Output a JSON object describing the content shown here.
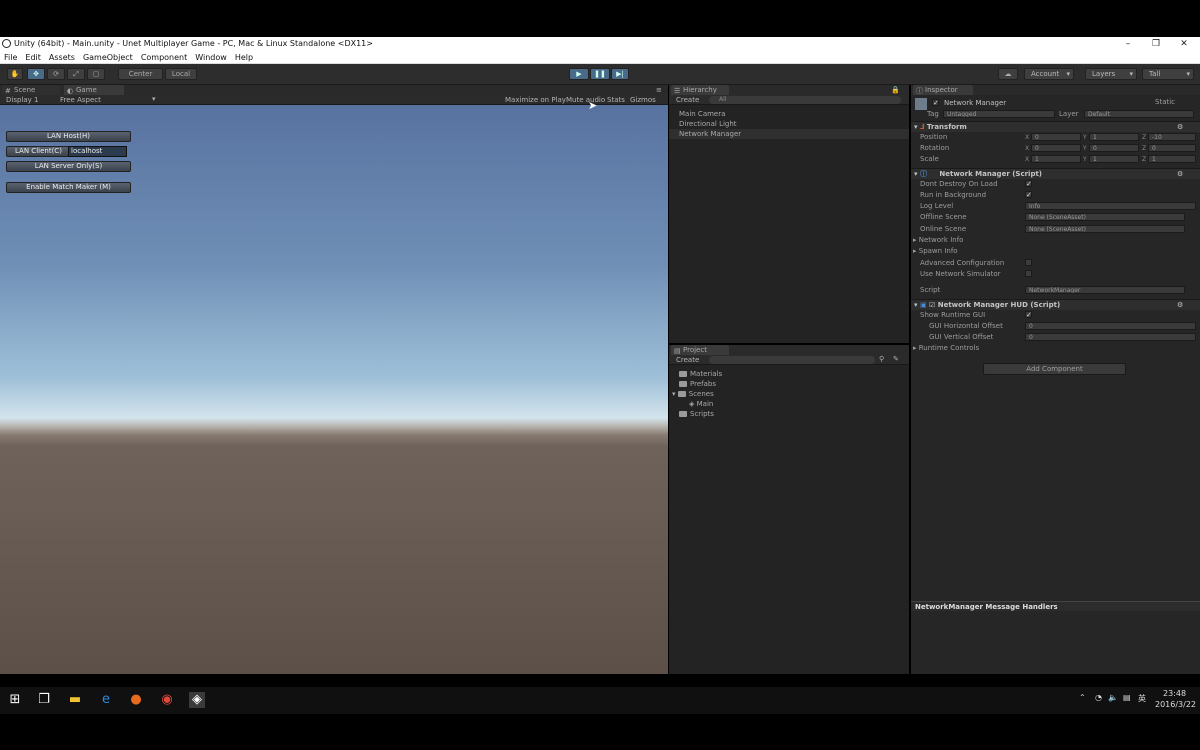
{
  "window": {
    "title": "Unity (64bit) - Main.unity - Unet Multiplayer Game - PC, Mac & Linux Standalone <DX11>",
    "minimize": "–",
    "restore": "❐",
    "close": "✕"
  },
  "menu": [
    "File",
    "Edit",
    "Assets",
    "GameObject",
    "Component",
    "Window",
    "Help"
  ],
  "toolbar": {
    "pivot": "Center",
    "space": "Local",
    "account": "Account",
    "layers": "Layers",
    "layout": "Tall"
  },
  "game_panel": {
    "tabs": [
      "Scene",
      "Game"
    ],
    "display": "Display 1",
    "aspect": "Free Aspect",
    "options": [
      "Maximize on Play",
      "Mute audio",
      "Stats",
      "Gizmos"
    ],
    "hud_buttons": [
      "LAN Host(H)",
      "LAN Client(C)",
      "LAN Server Only(S)",
      "Enable Match Maker (M)"
    ],
    "client_address": "localhost"
  },
  "hierarchy": {
    "tab": "Hierarchy",
    "create": "Create",
    "search_placeholder": "All",
    "items": [
      "Main Camera",
      "Directional Light",
      "Network Manager"
    ]
  },
  "project": {
    "tab": "Project",
    "create": "Create",
    "folders": [
      "Materials",
      "Prefabs",
      "Scenes",
      "Main",
      "Scripts"
    ]
  },
  "inspector": {
    "tab": "Inspector",
    "object_name": "Network Manager",
    "static_label": "Static",
    "tag_label": "Tag",
    "tag_value": "Untagged",
    "layer_label": "Layer",
    "layer_value": "Default",
    "transform": {
      "title": "Transform",
      "position_label": "Position",
      "rotation_label": "Rotation",
      "scale_label": "Scale",
      "axes": [
        "X",
        "Y",
        "Z"
      ],
      "position": [
        "0",
        "1",
        "-10"
      ],
      "rotation": [
        "0",
        "0",
        "0"
      ],
      "scale": [
        "1",
        "1",
        "1"
      ]
    },
    "network_manager": {
      "title": "Network Manager (Script)",
      "dont_destroy": "Dont Destroy On Load",
      "run_in_background": "Run in Background",
      "log_level_label": "Log Level",
      "log_level_value": "Info",
      "offline_scene_label": "Offline Scene",
      "offline_scene_value": "None (SceneAsset)",
      "online_scene_label": "Online Scene",
      "online_scene_value": "None (SceneAsset)",
      "network_info": "Network Info",
      "spawn_info": "Spawn Info",
      "advanced_config": "Advanced Configuration",
      "use_simulator": "Use Network Simulator",
      "script_label": "Script",
      "script_value": "NetworkManager"
    },
    "hud": {
      "title": "Network Manager HUD (Script)",
      "show_runtime_gui": "Show Runtime GUI",
      "gui_h_offset_label": "GUI Horizontal Offset",
      "gui_h_offset_value": "0",
      "gui_v_offset_label": "GUI Vertical Offset",
      "gui_v_offset_value": "0",
      "runtime_controls": "Runtime Controls"
    },
    "add_component": "Add Component",
    "message_handlers": "NetworkManager Message Handlers"
  },
  "taskbar": {
    "time": "23:48",
    "date": "2016/3/22",
    "ime": "英"
  }
}
